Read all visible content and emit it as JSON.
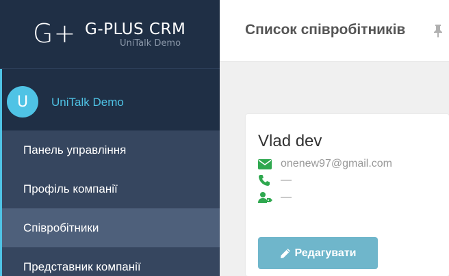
{
  "brand": {
    "logo": "G+",
    "name": "G-PLUS CRM",
    "subtitle": "UniTalk Demo"
  },
  "user": {
    "avatar_letter": "U",
    "name": "UniTalk Demo"
  },
  "menu": {
    "items": [
      {
        "label": "Панель управління"
      },
      {
        "label": "Профіль компанії"
      },
      {
        "label": "Співробітники"
      },
      {
        "label": "Представник компанії"
      }
    ],
    "active": "Співробітники"
  },
  "header": {
    "title": "Список співробітників"
  },
  "employee": {
    "name": "Vlad dev",
    "email": "onenew97@gmail.com",
    "phone": "—",
    "role": "—",
    "edit_label": "Редагувати"
  },
  "colors": {
    "sidebar_bg": "#1f2f45",
    "menu_bg": "#36465f",
    "menu_active_bg": "#4e607b",
    "accent": "#4fc3e5",
    "icon_green": "#2fa84f",
    "button": "#6fb6cb"
  },
  "icons": {
    "email": "envelope-icon",
    "phone": "phone-icon",
    "role": "user-tag-icon",
    "edit": "pencil-icon",
    "pin": "pin-icon"
  }
}
